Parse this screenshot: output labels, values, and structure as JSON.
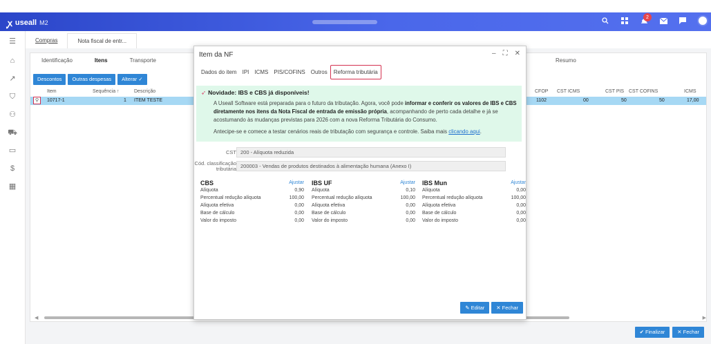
{
  "app": {
    "logo_text": "useall",
    "logo_sub": "M2",
    "notification_count": "2"
  },
  "subtabs": [
    "Compras",
    "Nota fiscal de entr..."
  ],
  "panel": {
    "tabs": [
      "Identificação",
      "Itens",
      "Transporte"
    ],
    "resumo_label": "Resumo",
    "buttons": [
      "Descontos",
      "Outras despesas",
      "Alterar ✓"
    ],
    "headers": {
      "item": "Item",
      "sequencia": "Sequência ↑",
      "descricao": "Descrição",
      "cfop": "CFOP",
      "cst_icms": "CST ICMS",
      "cst_pis": "CST PIS",
      "cst_cofins": "CST COFINS",
      "icms": "ICMS"
    },
    "row": {
      "item": "10717-1",
      "sequencia": "1",
      "descricao": "ITEM TESTE",
      "cfop": "1102",
      "cst_icms": "00",
      "cst_pis": "50",
      "cst_cofins": "50",
      "icms": "17,00"
    }
  },
  "footer": {
    "finalizar": "Finalizar",
    "fechar": "Fechar"
  },
  "modal": {
    "title": "Item da NF",
    "tabs": [
      "Dados do item",
      "IPI",
      "ICMS",
      "PIS/COFINS",
      "Outros",
      "Reforma tributária"
    ],
    "notice": {
      "title": "Novidade: IBS e CBS já disponíveis!",
      "p1_a": "A Useall Software está preparada para o futuro da tributação. Agora, você pode ",
      "p1_b": "informar e conferir os valores de IBS e CBS diretamente nos itens da Nota Fiscal de entrada de emissão própria",
      "p1_c": ", acompanhando de perto cada detalhe e já se acostumando às mudanças previstas para 2026 com a nova Reforma Tributária do Consumo.",
      "p2_a": "Antecipe-se e comece a testar cenários reais de tributação com segurança e controle. Saiba mais ",
      "p2_link": "clicando aqui",
      "p2_b": "."
    },
    "cst_label": "CST",
    "cst_value": "200 - Alíquota reduzida",
    "cclass_label1": "Cód. classificação",
    "cclass_label2": "tributária",
    "cclass_value": "200003 - Vendas de produtos destinados à alimentação humana (Anexo I)",
    "adjust_label": "Ajustar",
    "row_labels": [
      "Alíquota",
      "Percentual redução alíquota",
      "Alíquota efetiva",
      "Base de cálculo",
      "Valor do imposto"
    ],
    "cbs": {
      "title": "CBS",
      "values": [
        "0,90",
        "100,00",
        "0,00",
        "0,00",
        "0,00"
      ]
    },
    "ibs_uf": {
      "title": "IBS UF",
      "values": [
        "0,10",
        "100,00",
        "0,00",
        "0,00",
        "0,00"
      ]
    },
    "ibs_mun": {
      "title": "IBS Mun",
      "values": [
        "0,00",
        "100,00",
        "0,00",
        "0,00",
        "0,00"
      ]
    },
    "editar": "Editar",
    "fechar": "Fechar"
  }
}
